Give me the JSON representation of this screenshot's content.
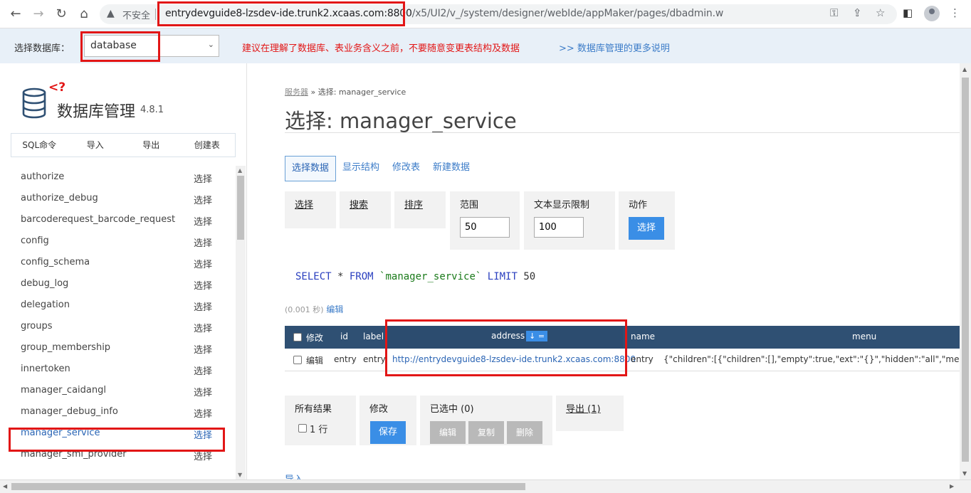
{
  "browser": {
    "back": "←",
    "forward": "→",
    "reload": "↻",
    "home": "⌂",
    "security_label": "不安全",
    "url_host": "entrydevguide8-lzsdev-ide.trunk2.xcaas.com",
    "url_port": ":8800",
    "url_path": "/x5/UI2/v_/system/designer/webIde/appMaker/pages/dbadmin.w"
  },
  "dbbar": {
    "label": "选择数据库：",
    "selected": "database",
    "warning": "建议在理解了数据库、表业务含义之前，不要随意变更表结构及数据",
    "more_link": ">> 数据库管理的更多说明"
  },
  "sidebar": {
    "title": "数据库管理",
    "version": "4.8.1",
    "menu": [
      "SQL命令",
      "导入",
      "导出",
      "创建表"
    ],
    "select_label": "选择",
    "tables": [
      "authorize",
      "authorize_debug",
      "barcoderequest_barcode_request",
      "config",
      "config_schema",
      "debug_log",
      "delegation",
      "groups",
      "group_membership",
      "innertoken",
      "manager_caidangl",
      "manager_debug_info",
      "manager_service",
      "manager_smi_provider"
    ],
    "active_table": "manager_service"
  },
  "main": {
    "breadcrumb_link": "服务器",
    "breadcrumb_rest": " » 选择: manager_service",
    "title": "选择: manager_service",
    "tabs": [
      "选择数据",
      "显示结构",
      "修改表",
      "新建数据"
    ],
    "fieldsets": {
      "select": "选择",
      "search": "搜索",
      "sort": "排序",
      "limit": "范围",
      "limit_value": "50",
      "text_limit": "文本显示限制",
      "text_limit_value": "100",
      "action": "动作",
      "action_button": "选择"
    },
    "sql": {
      "select": "SELECT",
      "star": " * ",
      "from": "FROM",
      "table": "`manager_service`",
      "limit": "LIMIT",
      "limit_value": "50"
    },
    "timing": "(0.001 秒)",
    "edit_link": "编辑",
    "grid": {
      "headers": {
        "modify": "修改",
        "id": "id",
        "label": "label",
        "address": "address",
        "sort_badge": "↓ =",
        "name": "name",
        "menu": "menu"
      },
      "row": {
        "edit": "编辑",
        "id": "entry",
        "label": "entry",
        "address": "http://entrydevguide8-lzsdev-ide.trunk2.xcaas.com:8800",
        "name": "entry",
        "menu": "{\"children\":[{\"children\":[],\"empty\":true,\"ext\":\"{}\",\"hidden\":\"all\",\"menuId\":\"/e"
      }
    },
    "bottom": {
      "all_results": "所有结果",
      "row_count": "1 行",
      "modify": "修改",
      "save": "保存",
      "selected": "已选中 (0)",
      "edit": "编辑",
      "copy": "复制",
      "delete": "删除",
      "export": "导出 (1)"
    },
    "import_link": "导入"
  }
}
